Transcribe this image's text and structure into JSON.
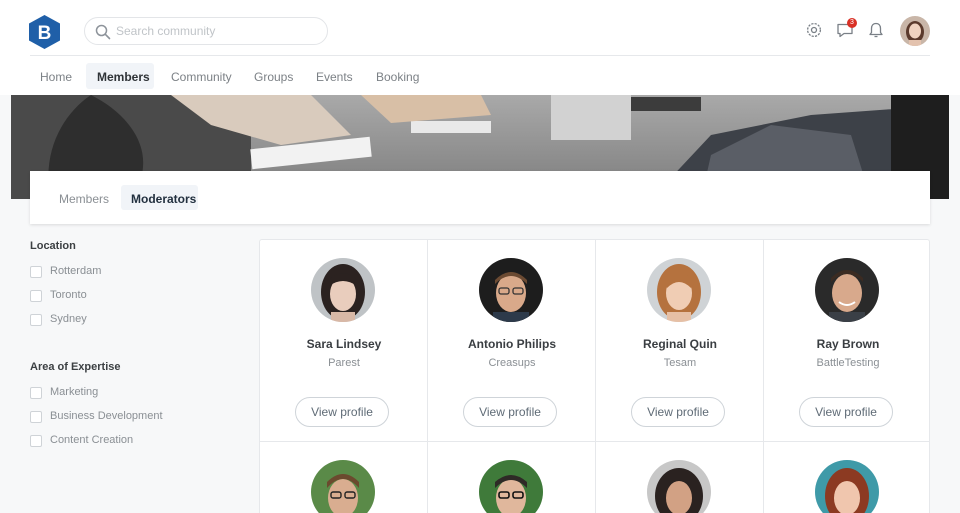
{
  "header": {
    "logo_letter": "B",
    "search_placeholder": "Search community",
    "notification_count": "3",
    "icons": [
      "gear-icon",
      "chat-icon",
      "bell-icon"
    ]
  },
  "nav": {
    "items": [
      "Home",
      "Members",
      "Community",
      "Groups",
      "Events",
      "Booking"
    ],
    "active": "Members"
  },
  "tabs": {
    "items": [
      "Members",
      "Moderators"
    ],
    "active": "Moderators"
  },
  "filters": [
    {
      "title": "Location",
      "options": [
        "Rotterdam",
        "Toronto",
        "Sydney"
      ]
    },
    {
      "title": "Area of Expertise",
      "options": [
        "Marketing",
        "Business Development",
        "Content Creation"
      ]
    }
  ],
  "members": [
    {
      "name": "Sara Lindsey",
      "company": "Parest",
      "button": "View profile"
    },
    {
      "name": "Antonio Philips",
      "company": "Creasups",
      "button": "View profile"
    },
    {
      "name": "Reginal Quin",
      "company": "Tesam",
      "button": "View profile"
    },
    {
      "name": "Ray Brown",
      "company": "BattleTesting",
      "button": "View profile"
    }
  ],
  "colors": {
    "brand": "#1f5fa8",
    "accent_bg": "#f1f4f8",
    "badge": "#d93025"
  }
}
